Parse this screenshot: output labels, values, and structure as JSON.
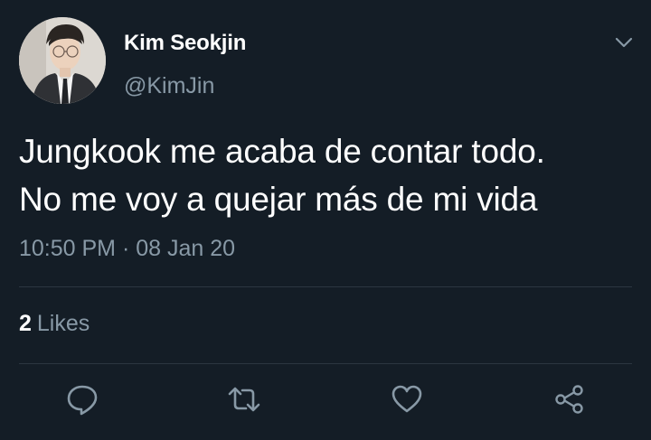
{
  "tweet": {
    "author": {
      "display_name": "Kim Seokjin",
      "handle": "@KimJin",
      "avatar": "profile-photo"
    },
    "text_lines": [
      "Jungkook me acaba de contar todo.",
      "No me voy a quejar más de mi vida"
    ],
    "time": "10:50 PM",
    "separator": "·",
    "date": "08 Jan 20",
    "stats": {
      "likes_count": "2",
      "likes_label": "Likes"
    },
    "actions": [
      {
        "name": "reply",
        "icon": "reply-bubble-icon"
      },
      {
        "name": "retweet",
        "icon": "retweet-icon"
      },
      {
        "name": "like",
        "icon": "heart-icon"
      },
      {
        "name": "share",
        "icon": "share-icon"
      }
    ],
    "menu_icon": "chevron-down-icon"
  },
  "colors": {
    "background": "#141d26",
    "primary_text": "#ffffff",
    "secondary_text": "#8899a6",
    "divider": "#2c3640"
  }
}
